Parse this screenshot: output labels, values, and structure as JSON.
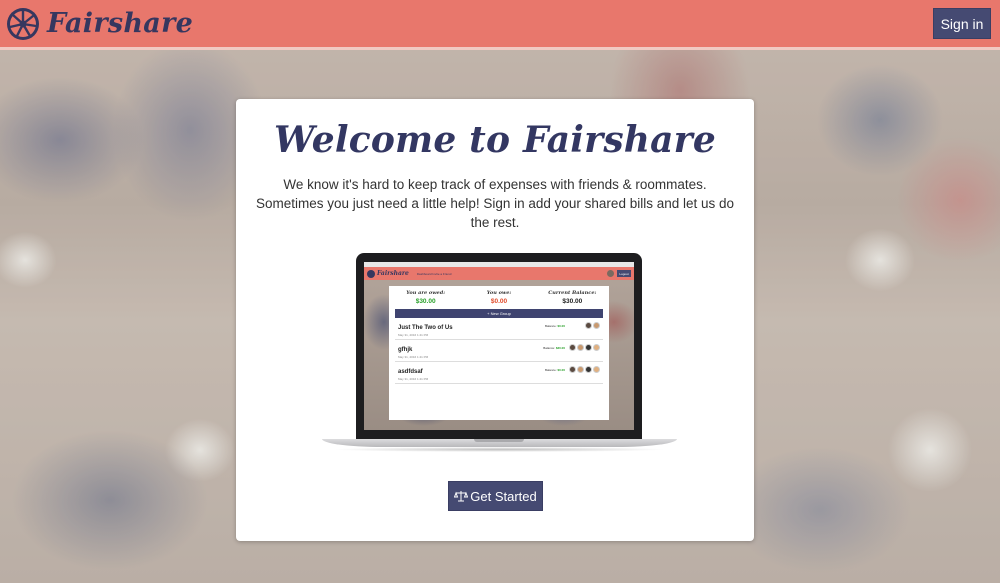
{
  "header": {
    "brand": "Fairshare",
    "signin_label": "Sign in",
    "colors": {
      "bar": "#e8776c",
      "brand_text": "#36375f",
      "button": "#454a72"
    }
  },
  "hero": {
    "title": "Welcome to Fairshare",
    "description": "We know it's hard to keep track of expenses with friends & roommates. Sometimes you just need a little help! Sign in add your shared bills and let us do the rest.",
    "cta_label": "Get Started",
    "cta_icon": "balance-scale-icon"
  },
  "preview": {
    "nav": {
      "brand": "Fairshare",
      "links": "Dashboard   Invite a Friend",
      "logout": "Logout"
    },
    "stats": [
      {
        "label": "You are owed:",
        "value": "$30.00",
        "color": "#2aa02a"
      },
      {
        "label": "You owe:",
        "value": "$0.00",
        "color": "#e04b2b"
      },
      {
        "label": "Current Balance:",
        "value": "$30.00",
        "color": "#222222"
      }
    ],
    "new_group_label": "+ New Group",
    "groups": [
      {
        "name": "Just The Two of Us",
        "date": "May 31, 2016 1:41 PM",
        "balance_label": "Balance:",
        "balance": "$0.00"
      },
      {
        "name": "gfhjk",
        "date": "May 31, 2016 1:41 PM",
        "balance_label": "Balance:",
        "balance": "$30.00"
      },
      {
        "name": "asdfdsaf",
        "date": "May 31, 2016 1:41 PM",
        "balance_label": "Balance:",
        "balance": "$0.00"
      }
    ]
  }
}
